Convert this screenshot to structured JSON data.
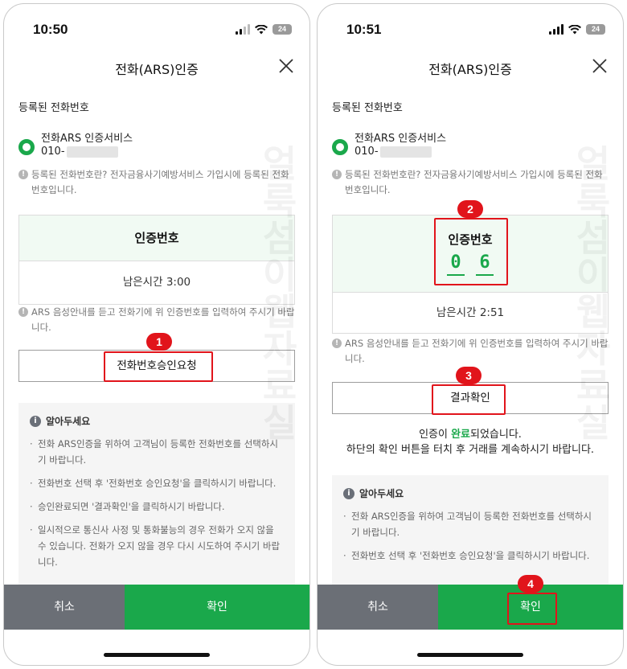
{
  "left": {
    "time": "10:50",
    "battery": "24",
    "title": "전화(ARS)인증",
    "registered_label": "등록된 전화번호",
    "service_name": "전화ARS 인증서비스",
    "phone_prefix": "010-",
    "note1": "등록된 전화번호란? 전자금융사기예방서비스 가입시에 등록된 전화번호입니다.",
    "auth_title": "인증번호",
    "remaining_time": "남은시간 3:00",
    "note2": "ARS 음성안내를 듣고 전화기에 위 인증번호를 입력하여 주시기 바랍니다.",
    "request_button": "전화번호승인요청",
    "badge": "1",
    "tips_title": "알아두세요",
    "tips": [
      "전화 ARS인증을 위하여 고객님이 등록한 전화번호를 선택하시기 바랍니다.",
      "전화번호 선택 후 '전화번호 승인요청'을 클릭하시기 바랍니다.",
      "승인완료되면 '결과확인'을 클릭하시기 바랍니다.",
      "일시적으로 통신사 사정 및 통화불능의 경우 전화가 오지 않을 수 있습니다. 전화가 오지 않을 경우 다시 시도하여 주시기 바랍니다."
    ],
    "cancel_button": "취소",
    "confirm_button": "확인"
  },
  "right": {
    "time": "10:51",
    "battery": "24",
    "title": "전화(ARS)인증",
    "registered_label": "등록된 전화번호",
    "service_name": "전화ARS 인증서비스",
    "phone_prefix": "010-",
    "note1": "등록된 전화번호란? 전자금융사기예방서비스 가입시에 등록된 전화번호입니다.",
    "auth_title": "인증번호",
    "digits": [
      "0",
      "6"
    ],
    "remaining_time": "남은시간 2:51",
    "note2": "ARS 음성안내를 듣고 전화기에 위 인증번호를 입력하여 주시기 바랍니다.",
    "result_button": "결과확인",
    "complete_pre": "인증이 ",
    "complete_green": "완료",
    "complete_post": "되었습니다.",
    "complete_line2": "하단의 확인 버튼을 터치 후 거래를 계속하시기 바랍니다.",
    "badges": [
      "2",
      "3",
      "4"
    ],
    "tips_title": "알아두세요",
    "tips": [
      "전화 ARS인증을 위하여 고객님이 등록한 전화번호를 선택하시기 바랍니다.",
      "전화번호 선택 후 '전화번호 승인요청'을 클릭하시기 바랍니다."
    ],
    "cancel_button": "취소",
    "confirm_button": "확인"
  },
  "watermark": "얼룩섬이웹자료실",
  "colors": {
    "accent_green": "#1aa84b",
    "cancel_gray": "#6b6f76",
    "highlight_red": "#e1141b"
  },
  "icons": [
    "signal-icon",
    "wifi-icon",
    "battery-icon",
    "close-icon",
    "radio-selected-icon",
    "info-icon"
  ]
}
